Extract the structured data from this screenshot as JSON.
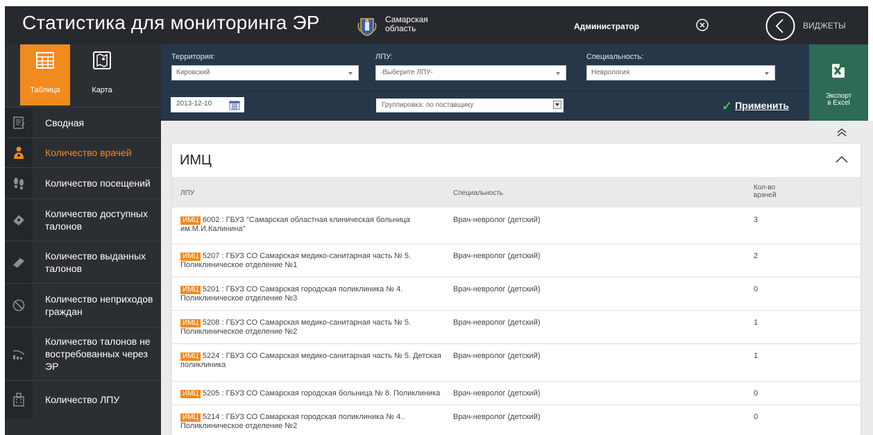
{
  "header": {
    "title": "Статистика для мониторинга ЭР",
    "region_line1": "Самарская",
    "region_line2": "область",
    "user": "Администратор",
    "widgets": "ВИДЖЕТЫ"
  },
  "view_tabs": [
    {
      "label": "Таблица",
      "icon": "table-icon",
      "active": true
    },
    {
      "label": "Карта",
      "icon": "map-icon",
      "active": false
    }
  ],
  "nav": [
    {
      "label": "Сводная",
      "icon": "summary-icon"
    },
    {
      "label": "Количество врачей",
      "icon": "doctor-icon",
      "active": true
    },
    {
      "label": "Количество посещений",
      "icon": "footprints-icon"
    },
    {
      "label": "Количество доступных талонов",
      "icon": "ticket-icon"
    },
    {
      "label": "Количество выданных талонов",
      "icon": "ticket-issued-icon"
    },
    {
      "label": "Количество неприходов граждан",
      "icon": "no-show-icon"
    },
    {
      "label": "Количество талонов не востребованных через ЭР",
      "icon": "chart-down-icon"
    },
    {
      "label": "Количество ЛПУ",
      "icon": "building-icon"
    }
  ],
  "filters": {
    "territory_label": "Территория:",
    "territory_value": "Кировский",
    "lpu_label": "ЛПУ:",
    "lpu_value": "-Выберите ЛПУ-",
    "specialty_label": "Специальность:",
    "specialty_value": "Неврология",
    "date": "2013-12-10",
    "grouping": "Группировка: по поставщику",
    "apply": "Применить"
  },
  "export": {
    "line1": "Экспорт",
    "line2": "в Excel"
  },
  "card": {
    "title": "ИМЦ",
    "columns": {
      "lpu": "ЛПУ",
      "specialty": "Специальность",
      "count_line1": "Кол-во",
      "count_line2": "врачей"
    },
    "rows": [
      {
        "tag": "ИМЦ",
        "lpu": "6002 : ГБУЗ \"Самарская областная клиническая больница им.М.И.Калинина\"",
        "specialty": "Врач-невролог (детский)",
        "count": "3"
      },
      {
        "tag": "ИМЦ",
        "lpu": "5207 : ГБУЗ СО Самарская медико-санитарная часть № 5. Поликлиническое отделение №1",
        "specialty": "Врач-невролог (детский)",
        "count": "2"
      },
      {
        "tag": "ИМЦ",
        "lpu": "5201 : ГБУЗ СО Самарская городская поликлиника № 4. Поликлиническое отделение №3",
        "specialty": "Врач-невролог (детский)",
        "count": "0"
      },
      {
        "tag": "ИМЦ",
        "lpu": "5208 : ГБУЗ СО Самарская медико-санитарная часть № 5. Поликлиническое отделение №2",
        "specialty": "Врач-невролог (детский)",
        "count": "1"
      },
      {
        "tag": "ИМЦ",
        "lpu": "5224 : ГБУЗ СО Самарская медико-санитарная часть № 5. Детская поликлиника",
        "specialty": "Врач-невролог (детский)",
        "count": "1"
      },
      {
        "tag": "ИМЦ",
        "lpu": "5205 : ГБУЗ СО Самарская городская больница № 8. Поликлиника",
        "specialty": "Врач-невролог (детский)",
        "count": "0"
      },
      {
        "tag": "ИМЦ",
        "lpu": "5214 : ГБУЗ СО Самарская городская поликлиника № 4.. Поликлиническое отделение №2",
        "specialty": "Врач-невролог (детский)",
        "count": "0"
      }
    ]
  },
  "colors": {
    "accent": "#f28b1e",
    "header": "#262a2f",
    "sidebar": "#2b2f33",
    "filter_bar": "#27374a",
    "excel": "#2d6b57",
    "apply_check": "#4cc24c"
  }
}
